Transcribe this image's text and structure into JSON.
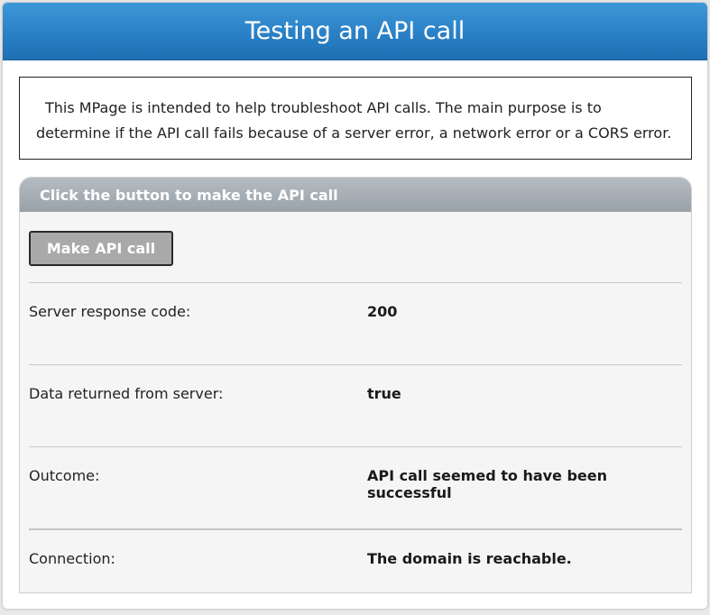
{
  "header": {
    "title": "Testing an API call"
  },
  "intro": {
    "text": "This MPage is intended to help troubleshoot API calls. The main purpose is to determine if the API call fails because of a server error, a network error or a CORS error."
  },
  "panel": {
    "title": "Click the button to make the API call",
    "button_label": "Make API call",
    "rows": [
      {
        "label": "Server response code:",
        "value": "200"
      },
      {
        "label": "Data returned from server:",
        "value": "true"
      },
      {
        "label": "Outcome:",
        "value": "API call seemed to have been successful"
      },
      {
        "label": "Connection:",
        "value": "The domain is reachable."
      }
    ]
  },
  "colors": {
    "header_blue": "#2a80c6",
    "panel_header_gray": "#9aa2a9",
    "button_gray": "#a9a9a9"
  }
}
